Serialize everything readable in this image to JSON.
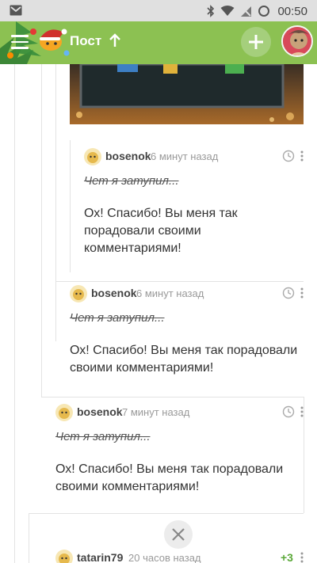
{
  "status_bar": {
    "time": "00:50"
  },
  "header": {
    "title": "Пост"
  },
  "comments": [
    {
      "author": "bosenok",
      "time": "6 минут назад",
      "strikethrough": "Чет я затупил...",
      "text": "Ох! Спасибо! Вы меня так порадовали своими комментариями!"
    },
    {
      "author": "bosenok",
      "time": "6 минут назад",
      "strikethrough": "Чет я затупил...",
      "text": "Ох! Спасибо! Вы меня так порадовали своими комментариями!"
    },
    {
      "author": "bosenok",
      "time": "7 минут назад",
      "strikethrough": "Чет я затупил...",
      "text": "Ох! Спасибо! Вы меня так порадовали своими комментариями!"
    },
    {
      "author": "tatarin79",
      "time": "20 часов назад",
      "rating": "+3"
    }
  ],
  "colors": {
    "appbar": "#8cc152",
    "rating": "#5aa838"
  }
}
